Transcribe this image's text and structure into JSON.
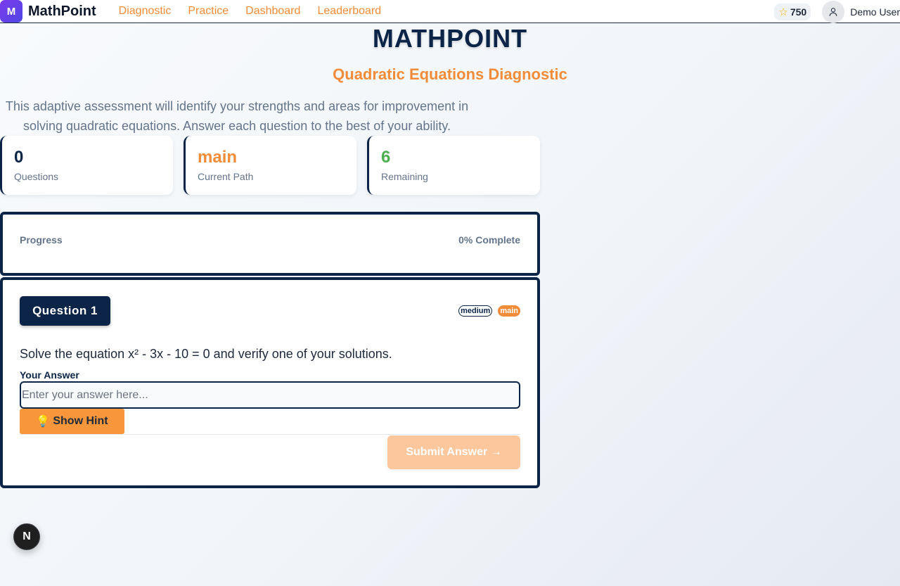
{
  "nav": {
    "logo_letter": "M",
    "brand": "MathPoint",
    "links": [
      "Diagnostic",
      "Practice",
      "Dashboard",
      "Leaderboard"
    ],
    "points": "750",
    "user": "Demo User"
  },
  "header": {
    "title": "MATHPOINT",
    "subtitle": "Quadratic Equations Diagnostic",
    "intro": "This adaptive assessment will identify your strengths and areas for improvement in solving quadratic equations. Answer each question to the best of your ability."
  },
  "stats": [
    {
      "value": "0",
      "label": "Questions",
      "color": "#0b2447"
    },
    {
      "value": "main",
      "label": "Current Path",
      "color": "#f28c38"
    },
    {
      "value": "6",
      "label": "Remaining",
      "color": "#4caf50"
    }
  ],
  "progress": {
    "label": "Progress",
    "complete_text": "0% Complete",
    "percent": 0
  },
  "question": {
    "badge": "Question 1",
    "difficulty": "medium",
    "path": "main",
    "text": "Solve the equation x² - 3x - 10 = 0 and verify one of your solutions.",
    "answer_label": "Your Answer",
    "answer_value": "",
    "answer_placeholder": "Enter your answer here...",
    "hint_label": "Show Hint",
    "hint_icon": "lightbulb-icon",
    "submit_label": "Submit Answer →"
  },
  "fab": {
    "letter": "N"
  },
  "colors": {
    "navy": "#0b2447",
    "accent": "#f28c38",
    "green": "#4caf50"
  }
}
